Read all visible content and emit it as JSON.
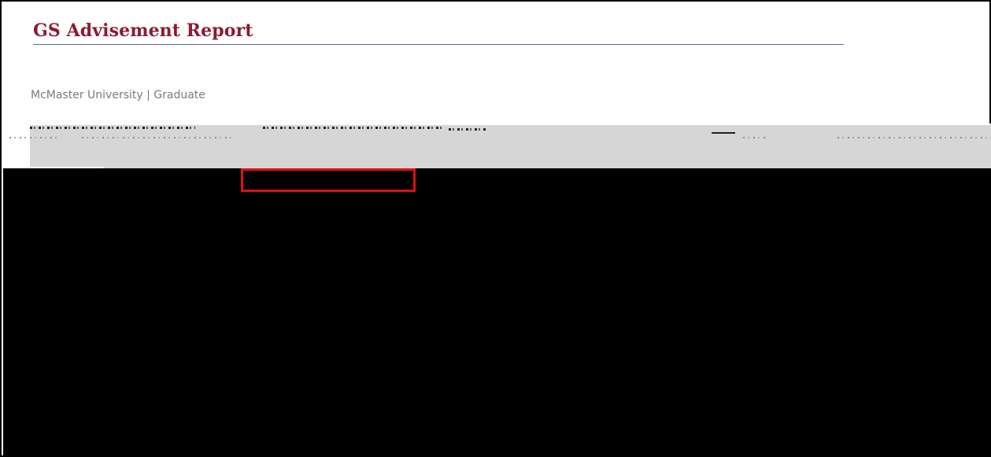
{
  "header": {
    "title": "GS Advisement Report",
    "title_color": "#8b1c33",
    "rule_color": "#5b6a8c"
  },
  "subheader": {
    "institution": "McMaster University | Graduate"
  },
  "colors": {
    "highlight": "#e01010",
    "obscured_area": "#000000",
    "band": "#d6d6d6"
  }
}
